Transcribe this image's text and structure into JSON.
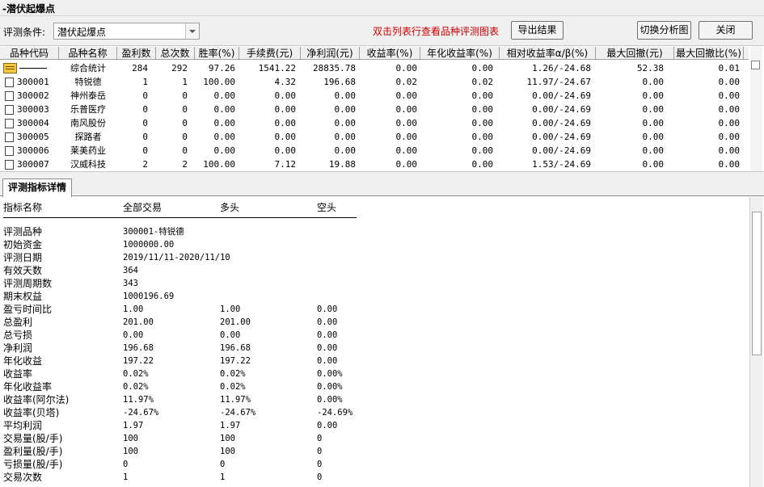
{
  "window": {
    "title": "-潜伏起爆点"
  },
  "toolbar": {
    "condition_label": "评测条件:",
    "condition_value": "潜伏起爆点",
    "hint": "双击列表行查看品种评测图表",
    "export_label": "导出结果",
    "switch_label": "切换分析图",
    "close_label": "关闭"
  },
  "table": {
    "columns": [
      "品种代码",
      "品种名称",
      "盈利数",
      "总次数",
      "胜率(%)",
      "手续费(元)",
      "净利润(元)",
      "收益率(%)",
      "年化收益率(%)",
      "相对收益率α/β(%)",
      "最大回撤(元)",
      "最大回撤比(%)"
    ],
    "summary": {
      "name": "综合统计",
      "wins": "284",
      "total": "292",
      "winrate": "97.26",
      "fee": "1541.22",
      "profit": "28835.78",
      "ret": "0.00",
      "annual": "0.00",
      "rel": "1.26/-24.68",
      "maxdd": "52.38",
      "maxddr": "0.01"
    },
    "rows": [
      {
        "code": "300001",
        "name": "特锐德",
        "wins": "1",
        "total": "1",
        "winrate": "100.00",
        "fee": "4.32",
        "profit": "196.68",
        "ret": "0.02",
        "annual": "0.02",
        "rel": "11.97/-24.67",
        "maxdd": "0.00",
        "maxddr": "0.00"
      },
      {
        "code": "300002",
        "name": "神州泰岳",
        "wins": "0",
        "total": "0",
        "winrate": "0.00",
        "fee": "0.00",
        "profit": "0.00",
        "ret": "0.00",
        "annual": "0.00",
        "rel": "0.00/-24.69",
        "maxdd": "0.00",
        "maxddr": "0.00"
      },
      {
        "code": "300003",
        "name": "乐普医疗",
        "wins": "0",
        "total": "0",
        "winrate": "0.00",
        "fee": "0.00",
        "profit": "0.00",
        "ret": "0.00",
        "annual": "0.00",
        "rel": "0.00/-24.69",
        "maxdd": "0.00",
        "maxddr": "0.00"
      },
      {
        "code": "300004",
        "name": "南风股份",
        "wins": "0",
        "total": "0",
        "winrate": "0.00",
        "fee": "0.00",
        "profit": "0.00",
        "ret": "0.00",
        "annual": "0.00",
        "rel": "0.00/-24.69",
        "maxdd": "0.00",
        "maxddr": "0.00"
      },
      {
        "code": "300005",
        "name": "探路者",
        "wins": "0",
        "total": "0",
        "winrate": "0.00",
        "fee": "0.00",
        "profit": "0.00",
        "ret": "0.00",
        "annual": "0.00",
        "rel": "0.00/-24.69",
        "maxdd": "0.00",
        "maxddr": "0.00"
      },
      {
        "code": "300006",
        "name": "莱美药业",
        "wins": "0",
        "total": "0",
        "winrate": "0.00",
        "fee": "0.00",
        "profit": "0.00",
        "ret": "0.00",
        "annual": "0.00",
        "rel": "0.00/-24.69",
        "maxdd": "0.00",
        "maxddr": "0.00"
      },
      {
        "code": "300007",
        "name": "汉威科技",
        "wins": "2",
        "total": "2",
        "winrate": "100.00",
        "fee": "7.12",
        "profit": "19.88",
        "ret": "0.00",
        "annual": "0.00",
        "rel": "1.53/-24.69",
        "maxdd": "0.00",
        "maxddr": "0.00"
      }
    ]
  },
  "detail": {
    "tab_label": "评测指标详情",
    "headers": {
      "name": "指标名称",
      "all": "全部交易",
      "long": "多头",
      "short": "空头"
    },
    "rows": [
      {
        "k": "评测品种",
        "v1": "300001-特锐德",
        "v2": "",
        "v3": ""
      },
      {
        "k": "初始资金",
        "v1": "1000000.00",
        "v2": "",
        "v3": ""
      },
      {
        "k": "评测日期",
        "v1": "2019/11/11-2020/11/10",
        "v2": "",
        "v3": ""
      },
      {
        "k": "有效天数",
        "v1": "364",
        "v2": "",
        "v3": ""
      },
      {
        "k": "评测周期数",
        "v1": "343",
        "v2": "",
        "v3": ""
      },
      {
        "k": "期末权益",
        "v1": "1000196.69",
        "v2": "",
        "v3": ""
      },
      {
        "k": "盈亏时间比",
        "v1": "1.00",
        "v2": "1.00",
        "v3": "0.00"
      },
      {
        "k": "总盈利",
        "v1": "201.00",
        "v2": "201.00",
        "v3": "0.00"
      },
      {
        "k": "总亏损",
        "v1": "0.00",
        "v2": "0.00",
        "v3": "0.00"
      },
      {
        "k": "净利润",
        "v1": "196.68",
        "v2": "196.68",
        "v3": "0.00"
      },
      {
        "k": "年化收益",
        "v1": "197.22",
        "v2": "197.22",
        "v3": "0.00"
      },
      {
        "k": "收益率",
        "v1": "0.02%",
        "v2": "0.02%",
        "v3": "0.00%"
      },
      {
        "k": "年化收益率",
        "v1": "0.02%",
        "v2": "0.02%",
        "v3": "0.00%"
      },
      {
        "k": "收益率(阿尔法)",
        "v1": "11.97%",
        "v2": "11.97%",
        "v3": "0.00%"
      },
      {
        "k": "收益率(贝塔)",
        "v1": "-24.67%",
        "v2": "-24.67%",
        "v3": "-24.69%"
      },
      {
        "k": "平均利润",
        "v1": "1.97",
        "v2": "1.97",
        "v3": "0.00"
      },
      {
        "k": "交易量(股/手)",
        "v1": "100",
        "v2": "100",
        "v3": "0"
      },
      {
        "k": "盈利量(股/手)",
        "v1": "100",
        "v2": "100",
        "v3": "0"
      },
      {
        "k": "亏损量(股/手)",
        "v1": "0",
        "v2": "0",
        "v3": "0"
      },
      {
        "k": "交易次数",
        "v1": "1",
        "v2": "1",
        "v3": "0"
      }
    ]
  }
}
